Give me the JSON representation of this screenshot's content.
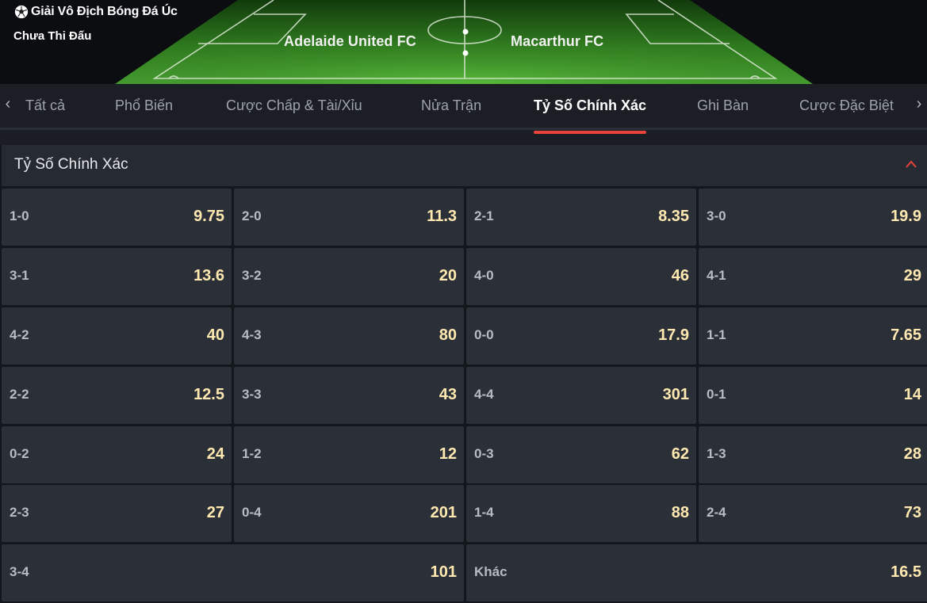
{
  "header": {
    "league": "Giải Vô Địch Bóng Đá Úc",
    "status": "Chưa Thi Đấu",
    "home_team": "Adelaide United FC",
    "away_team": "Macarthur FC"
  },
  "tabs": [
    {
      "label": "Tất cả"
    },
    {
      "label": "Phổ Biến"
    },
    {
      "label": "Cược Chấp & Tài/Xỉu"
    },
    {
      "label": "Nửa Trận"
    },
    {
      "label": "Tỷ Số Chính Xác",
      "active": true
    },
    {
      "label": "Ghi Bàn"
    },
    {
      "label": "Cược Đặc Biệt"
    }
  ],
  "panel": {
    "title": "Tỷ Số Chính Xác",
    "rows": [
      [
        {
          "score": "1-0",
          "odds": "9.75"
        },
        {
          "score": "2-0",
          "odds": "11.3"
        },
        {
          "score": "2-1",
          "odds": "8.35"
        },
        {
          "score": "3-0",
          "odds": "19.9"
        }
      ],
      [
        {
          "score": "3-1",
          "odds": "13.6"
        },
        {
          "score": "3-2",
          "odds": "20"
        },
        {
          "score": "4-0",
          "odds": "46"
        },
        {
          "score": "4-1",
          "odds": "29"
        }
      ],
      [
        {
          "score": "4-2",
          "odds": "40"
        },
        {
          "score": "4-3",
          "odds": "80"
        },
        {
          "score": "0-0",
          "odds": "17.9"
        },
        {
          "score": "1-1",
          "odds": "7.65"
        }
      ],
      [
        {
          "score": "2-2",
          "odds": "12.5"
        },
        {
          "score": "3-3",
          "odds": "43"
        },
        {
          "score": "4-4",
          "odds": "301"
        },
        {
          "score": "0-1",
          "odds": "14"
        }
      ],
      [
        {
          "score": "0-2",
          "odds": "24"
        },
        {
          "score": "1-2",
          "odds": "12"
        },
        {
          "score": "0-3",
          "odds": "62"
        },
        {
          "score": "1-3",
          "odds": "28"
        }
      ],
      [
        {
          "score": "2-3",
          "odds": "27"
        },
        {
          "score": "0-4",
          "odds": "201"
        },
        {
          "score": "1-4",
          "odds": "88"
        },
        {
          "score": "2-4",
          "odds": "73"
        }
      ],
      [
        {
          "score": "3-4",
          "odds": "101"
        },
        {
          "score": "Khác",
          "odds": "16.5"
        }
      ]
    ]
  },
  "colors": {
    "accent": "#e8423b",
    "odds_text": "#ffe9b0",
    "cell_bg": "#2b2f37",
    "pitch_green": "#3f9a2c"
  },
  "icons": {
    "league": "soccer-ball-icon",
    "collapse": "chevron-up-icon",
    "tabs_prev": "chevron-left-icon",
    "tabs_next": "chevron-right-icon"
  }
}
